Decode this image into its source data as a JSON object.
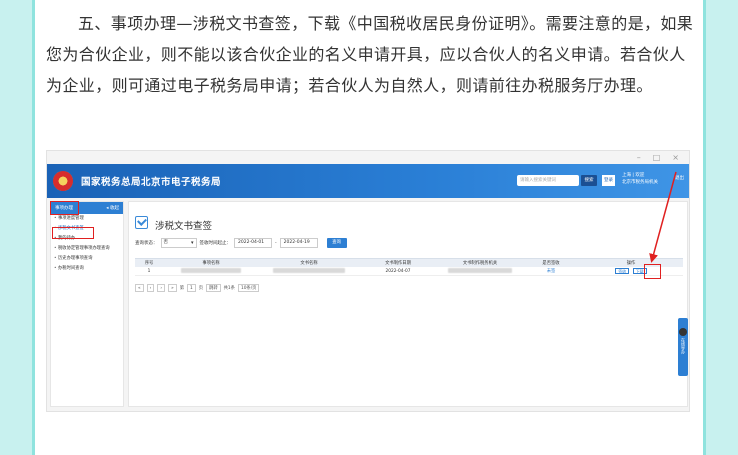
{
  "article": {
    "paragraph": "五、事项办理—涉税文书查签，下载《中国税收居民身份证明》。需要注意的是，如果您为合伙企业，则不能以该合伙企业的名义申请开具，应以合伙人的名义申请。若合伙人为企业，则可通过电子税务局申请；若合伙人为自然人，则请前往办税服务厅办理。"
  },
  "window": {
    "controls": [
      "–",
      "□",
      "×"
    ]
  },
  "header": {
    "site_title": "国家税务总局北京市电子税务局",
    "search_placeholder": "请输入搜索关键词",
    "search_button": "搜索",
    "login_button": "登录",
    "user_line1": "上海 | 欢迎",
    "user_line2": "北京市税务局机关",
    "exit": "退出"
  },
  "sidebar": {
    "top_label": "事项办理",
    "collapse_label": "◂ 收起",
    "items": [
      {
        "label": "事项进度管理"
      },
      {
        "label": "涉税文书查签"
      },
      {
        "label": "我的待办"
      },
      {
        "label": "税收协定管理事项办理查询"
      },
      {
        "label": "历史办理事项查询"
      },
      {
        "label": "办税时间查询"
      }
    ]
  },
  "main": {
    "page_title": "涉税文书查签",
    "filter_type_label": "查询状态：",
    "filter_type_value": "否",
    "filter_date_label": "签收时间起止：",
    "date_from": "2022-04-01",
    "date_sep": "-",
    "date_to": "2022-04-19",
    "query_button": "查询",
    "columns": [
      "序号",
      "事项名称",
      "文书名称",
      "文书制作日期",
      "文书制作税务机关",
      "是否签收",
      "操作"
    ],
    "rows": [
      {
        "index": "1",
        "date": "2022-04-07",
        "status": "未签",
        "ops": [
          "签收",
          "下载"
        ]
      }
    ],
    "pager": {
      "first": "«",
      "prev": "‹",
      "next": "›",
      "last": "»",
      "page_label": "第",
      "page_value": "1",
      "of_label": "页",
      "go_button": "跳转",
      "total": "共1条",
      "page_size": "10条/页"
    }
  },
  "float_bar": {
    "text": "在线导办"
  },
  "colors": {
    "header_blue": "#1a62b6",
    "accent_blue": "#2d7fd3",
    "highlight_red": "#e02020",
    "frame_teal": "#8fe3de"
  }
}
